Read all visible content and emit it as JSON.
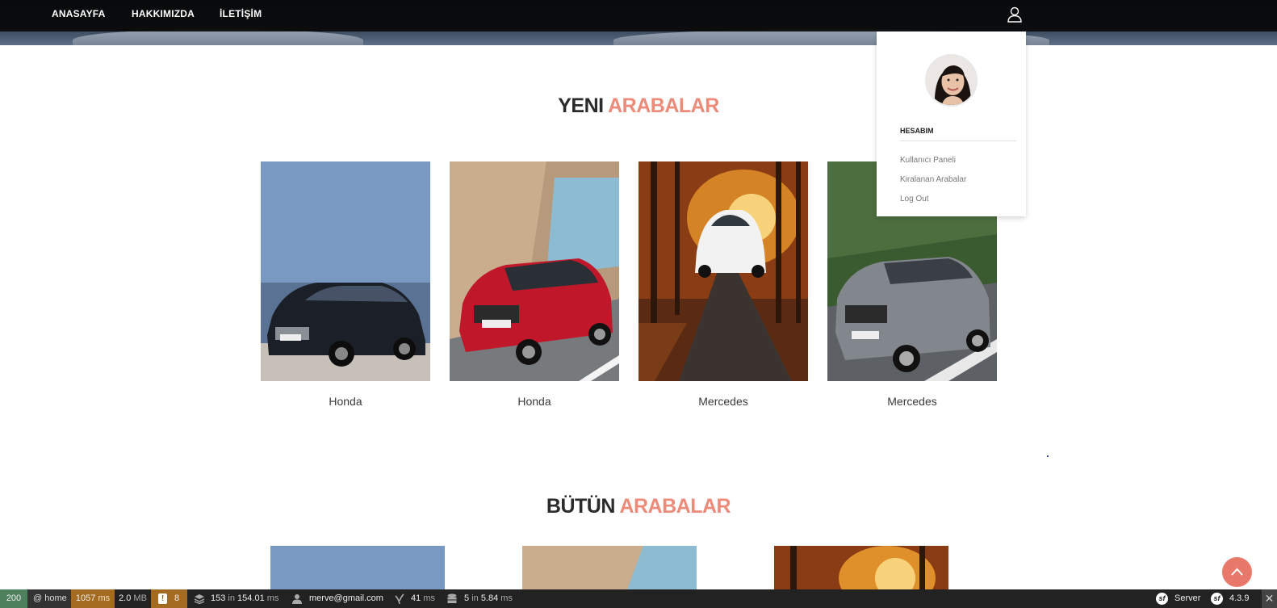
{
  "nav": {
    "items": [
      {
        "label": "ANASAYFA"
      },
      {
        "label": "HAKKIMIZDA"
      },
      {
        "label": "İLETİŞİM"
      }
    ],
    "user_icon": "user-outline-icon"
  },
  "sections": {
    "new_cars": {
      "title_dark": "YENI",
      "title_accent": "ARABALAR"
    },
    "all_cars": {
      "title_dark": "BÜTÜN",
      "title_accent": "ARABALAR"
    }
  },
  "new_cars": [
    {
      "name": "Honda",
      "image": "black-sedan"
    },
    {
      "name": "Honda",
      "image": "red-sedan"
    },
    {
      "name": "Mercedes",
      "image": "white-sportscar-autumn"
    },
    {
      "name": "Mercedes",
      "image": "grey-convertible"
    }
  ],
  "user_menu": {
    "heading": "HESABIM",
    "links": [
      "Kullanıcı Paneli",
      "Kiralanan Arabalar",
      "Log Out"
    ]
  },
  "toolbar": {
    "status": "200",
    "route": "@ home",
    "time_value": "1057",
    "time_unit": "ms",
    "memory_value": "2.0",
    "memory_unit": "MB",
    "log_count": "8",
    "cache": {
      "count": "153",
      "in": "in",
      "time": "154.01",
      "unit": "ms"
    },
    "user": "merve@gmail.com",
    "twig": {
      "value": "41",
      "unit": "ms"
    },
    "db": {
      "count": "5",
      "in": "in",
      "time": "5.84",
      "unit": "ms"
    },
    "server": "Server",
    "version": "4.3.9"
  },
  "colors": {
    "accent": "#ec8b7a",
    "scroll_button": "#e8796a",
    "nav_bg": "#080808",
    "status_ok": "#4f805d",
    "warning": "#a46a1f"
  }
}
